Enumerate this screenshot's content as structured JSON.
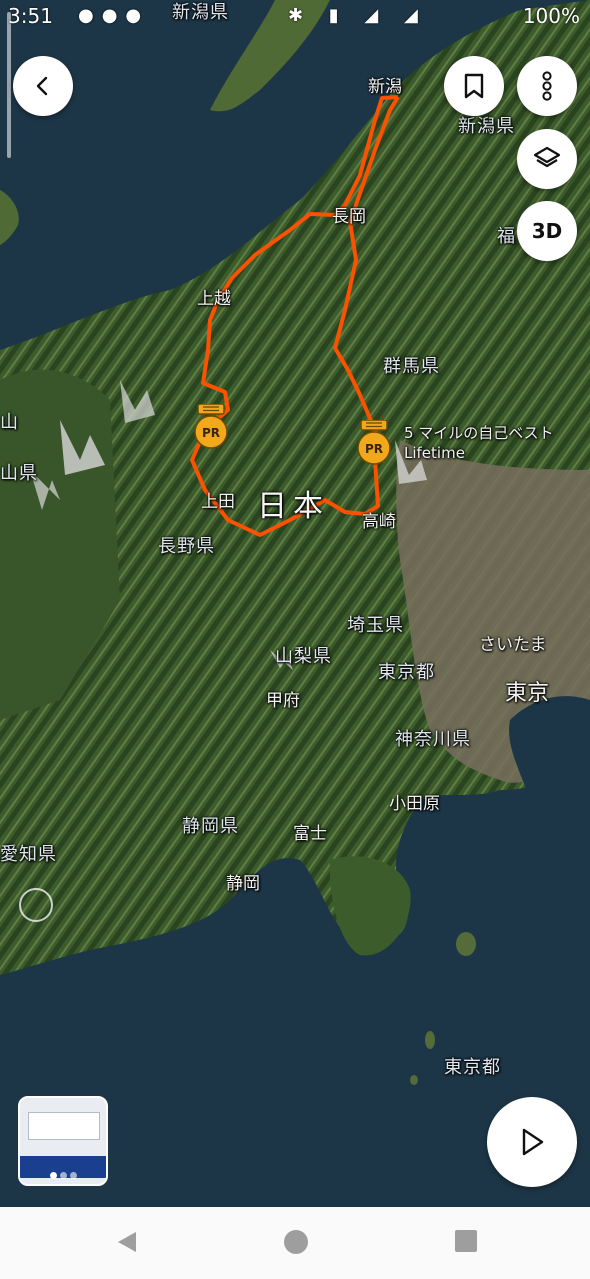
{
  "status_bar": {
    "time": "3:51",
    "battery": "100%"
  },
  "map": {
    "prefectures": [
      "新潟県",
      "新潟県",
      "群馬県",
      "長野県",
      "山梨県",
      "埼玉県",
      "東京都",
      "神奈川県",
      "静岡県",
      "愛知県",
      "東京都",
      "福",
      "山県",
      "山"
    ],
    "cities": [
      "新潟",
      "長岡",
      "上越",
      "上田",
      "高崎",
      "甲府",
      "小田原",
      "富士",
      "静岡",
      "さいたま"
    ],
    "big_cities": [
      "東京"
    ],
    "country": "日本",
    "pr_marker_text": [
      "5 マイルの自己ベスト",
      "Lifetime"
    ]
  },
  "buttons": {
    "three_d": "3D"
  },
  "icons": {
    "back": "chevron-left-icon",
    "bookmark": "bookmark-icon",
    "more": "more-vertical-icon",
    "layers": "layers-icon",
    "play": "play-icon",
    "info": "info-icon",
    "pr_badge": "personal-record-medal-icon"
  },
  "colors": {
    "route": "#fc5200",
    "badge": "#f2a81d",
    "fab_bg": "#ffffff"
  },
  "pr_badge_text": "PR",
  "photo_thumbnail": {
    "photo_count": 3,
    "selected_index": 0
  }
}
